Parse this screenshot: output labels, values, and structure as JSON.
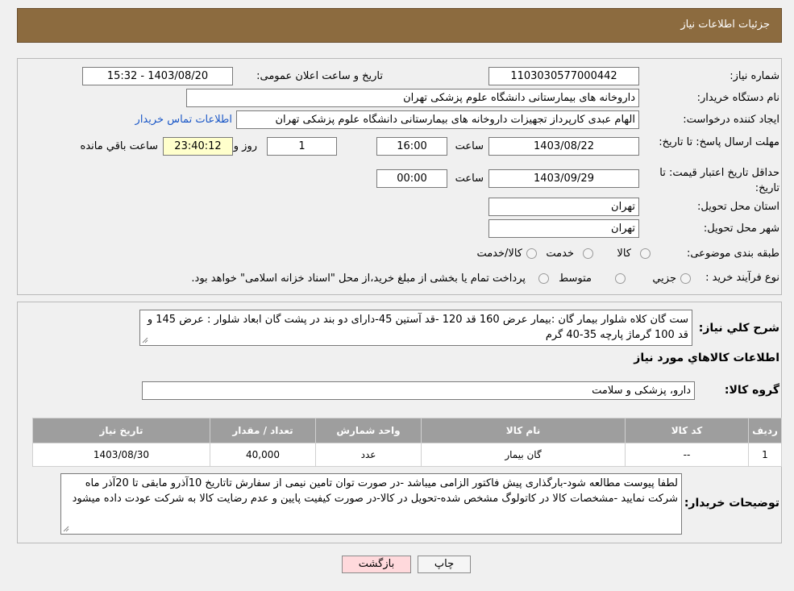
{
  "header": {
    "title": "جزئیات اطلاعات نیاز"
  },
  "form": {
    "need_number_label": "شماره نیاز:",
    "need_number": "1103030577000442",
    "announce_datetime_label": "تاریخ و ساعت اعلان عمومی:",
    "announce_datetime": "1403/08/20 - 15:32",
    "buyer_org_label": "نام دستگاه خریدار:",
    "buyer_org": "داروخانه های بیمارستانی دانشگاه علوم پزشکی تهران",
    "requester_label": "ایجاد کننده درخواست:",
    "requester": "الهام عبدی کارپرداز تجهیزات داروخانه های بیمارستانی دانشگاه علوم پزشکی تهران",
    "contact_link": "اطلاعات تماس خریدار",
    "reply_deadline_label": "مهلت ارسال پاسخ: تا تاریخ:",
    "reply_date": "1403/08/22",
    "time_label": "ساعت",
    "reply_time": "16:00",
    "days_value": "1",
    "days_label": "روز و",
    "remaining_time": "23:40:12",
    "remaining_label": "ساعت باقي مانده",
    "price_validity_label": "حداقل تاریخ اعتبار قیمت: تا تاریخ:",
    "validity_date": "1403/09/29",
    "validity_time": "00:00",
    "province_label": "استان محل تحویل:",
    "province": "تهران",
    "city_label": "شهر محل تحویل:",
    "city": "تهران",
    "category_label": "طبقه بندی موضوعی:",
    "category_options": [
      "کالا",
      "خدمت",
      "کالا/خدمت"
    ],
    "process_label": "نوع فرآیند خرید :",
    "process_options": [
      "جزیي",
      "متوسط"
    ],
    "process_note": "پرداخت تمام یا بخشی از مبلغ خرید،از محل \"اسناد خزانه اسلامی\" خواهد بود."
  },
  "summary": {
    "label": "شرح کلي نياز:",
    "text": "ست گان کلاه شلوار بیمار گان :بیمار عرض 160 قد 120 -قد آستین 45-دارای دو بند در پشت گان ابعاد شلوار : عرض 145 و قد 100 گرماژ پارچه 35-40 گرم",
    "goods_info_title": "اطلاعات کالاهاي مورد نياز",
    "group_label": "گروه کالا:",
    "group_value": "دارو، پزشکی و سلامت"
  },
  "table": {
    "headers": [
      "ردیف",
      "کد کالا",
      "نام کالا",
      "واحد شمارش",
      "تعداد / مقدار",
      "تاریخ نیاز"
    ],
    "rows": [
      [
        "1",
        "--",
        "گان بیمار",
        "عدد",
        "40,000",
        "1403/08/30"
      ]
    ]
  },
  "buyer_notes": {
    "label": "توضیحات خریدار:",
    "text": "لطفا پیوست مطالعه شود-بارگذاری پیش فاکتور الزامی میباشد -در صورت توان تامین نیمی از سفارش تاتاریخ 10آذرو مابقی تا 20آذر ماه شرکت نمایید -مشخصات کالا در کاتولوگ مشخص شده-تحویل در کالا-در صورت کیفیت پایین و عدم رضایت کالا به شرکت عودت داده میشود"
  },
  "buttons": {
    "print": "چاپ",
    "back": "بازگشت"
  },
  "colors": {
    "header": "#8c6b3f",
    "table_header": "#9e9e9e",
    "link": "#1a57c7",
    "back_button": "#ffd9dc"
  }
}
